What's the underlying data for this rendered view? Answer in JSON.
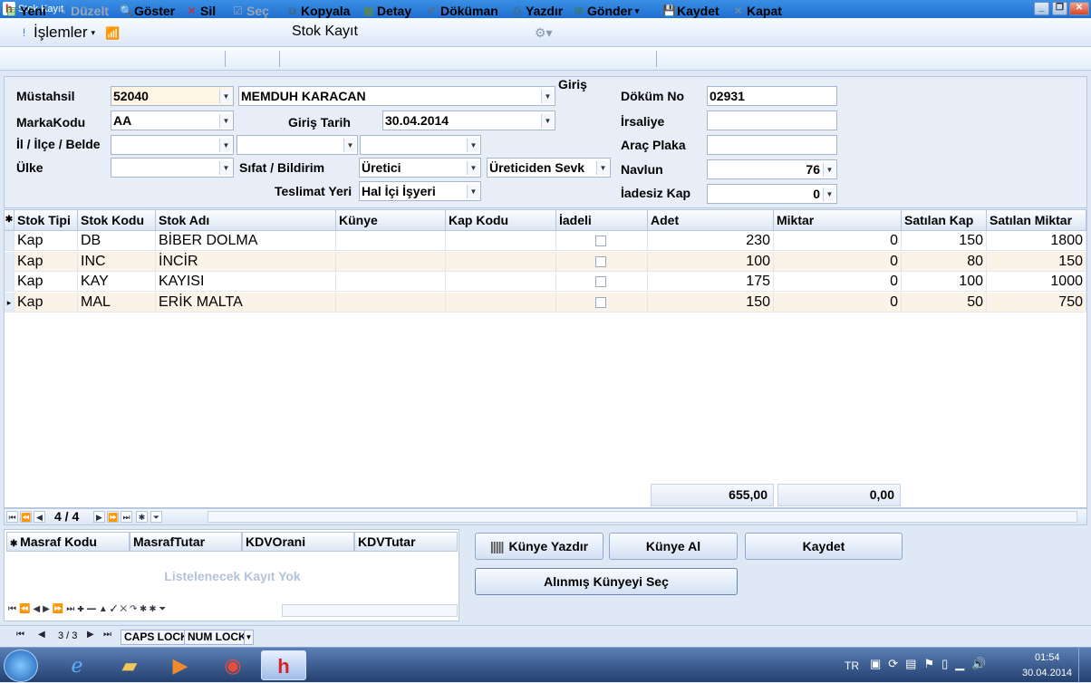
{
  "window": {
    "title": "Stok Kayıt"
  },
  "menu": {
    "islemler": "İşlemler",
    "page_title": "Stok Kayıt"
  },
  "toolbar": {
    "yeni": "Yeni",
    "duzelt": "Düzelt",
    "goster": "Göster",
    "sil": "Sil",
    "sec": "Seç",
    "kopyala": "Kopyala",
    "detay": "Detay",
    "dokuman": "Döküman",
    "yazdir": "Yazdır",
    "gonder": "Gönder",
    "kaydet": "Kaydet",
    "kapat": "Kapat"
  },
  "form": {
    "mustahsil_label": "Müstahsil",
    "mustahsil_code": "52040",
    "mustahsil_name": "MEMDUH KARACAN",
    "giris_label": "Giriş",
    "marka_label": "MarkaKodu",
    "marka_value": "AA",
    "giris_tarih_label": "Giriş Tarih",
    "giris_tarih_value": "30.04.2014",
    "il_label": "İl / İlçe / Belde",
    "ulke_label": "Ülke",
    "sifat_label": "Sıfat / Bildirim",
    "sifat_value": "Üretici",
    "bildirim_value": "Üreticiden Sevk",
    "teslimat_label": "Teslimat Yeri",
    "teslimat_value": "Hal İçi İşyeri",
    "dokum_no_label": "Döküm No",
    "dokum_no_value": "02931",
    "irsaliye_label": "İrsaliye",
    "arac_plaka_label": "Araç Plaka",
    "navlun_label": "Navlun",
    "navlun_value": "76",
    "iadesiz_kap_label": "İadesiz Kap",
    "iadesiz_kap_value": "0"
  },
  "grid": {
    "columns": [
      "Stok Tipi",
      "Stok Kodu",
      "Stok Adı",
      "Künye",
      "Kap Kodu",
      "İadeli",
      "Adet",
      "Miktar",
      "Satılan Kap",
      "Satılan Miktar"
    ],
    "rows": [
      {
        "tip": "Kap",
        "kod": "DB",
        "ad": "BİBER DOLMA",
        "kunye": "",
        "kap_kodu": "",
        "iadeli": false,
        "adet": "230",
        "miktar": "0",
        "satilan_kap": "150",
        "satilan_miktar": "1800"
      },
      {
        "tip": "Kap",
        "kod": "INC",
        "ad": "İNCİR",
        "kunye": "",
        "kap_kodu": "",
        "iadeli": false,
        "adet": "100",
        "miktar": "0",
        "satilan_kap": "80",
        "satilan_miktar": "150"
      },
      {
        "tip": "Kap",
        "kod": "KAY",
        "ad": "KAYISI",
        "kunye": "",
        "kap_kodu": "",
        "iadeli": false,
        "adet": "175",
        "miktar": "0",
        "satilan_kap": "100",
        "satilan_miktar": "1000"
      },
      {
        "tip": "Kap",
        "kod": "MAL",
        "ad": "ERİK MALTA",
        "kunye": "",
        "kap_kodu": "",
        "iadeli": false,
        "adet": "150",
        "miktar": "0",
        "satilan_kap": "50",
        "satilan_miktar": "750"
      }
    ],
    "total_adet": "655,00",
    "total_miktar": "0,00",
    "page_indicator": "4 / 4"
  },
  "masraf": {
    "columns": [
      "Masraf Kodu",
      "MasrafTutar",
      "KDVOrani",
      "KDVTutar"
    ],
    "empty_text": "Listelenecek Kayıt Yok"
  },
  "buttons": {
    "kunye_yazdir": "Künye Yazdır",
    "kunye_al": "Künye Al",
    "kaydet": "Kaydet",
    "alinmis_kunye": "Alınmış Künyeyi Seç"
  },
  "status": {
    "pager": "3 / 3",
    "caps": "CAPS LOCK",
    "num": "NUM LOCK"
  },
  "taskbar": {
    "lang": "TR",
    "time": "01:54",
    "date": "30.04.2014"
  }
}
